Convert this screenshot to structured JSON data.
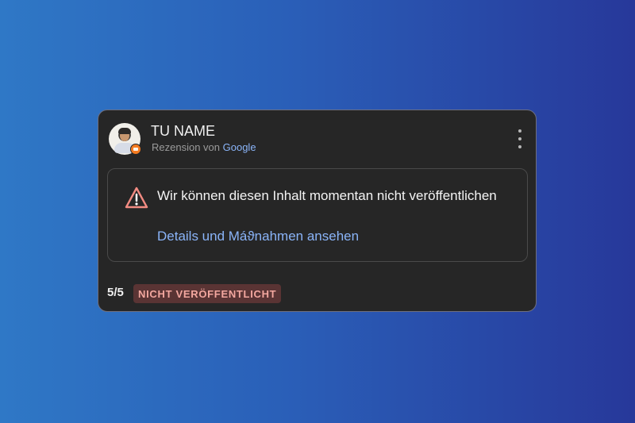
{
  "review_card": {
    "user_name": "TU NAME",
    "source_prefix": "Rezension von",
    "source_provider": "Google",
    "menu_icon": "more-vert-icon",
    "notice": {
      "icon": "warning-icon",
      "message": "Wir können diesen Inhalt momentan nicht veröffentlichen",
      "link_label": "Details und Máϑnahmen ansehen"
    },
    "rating": "5/5",
    "status": "NICHT VERÖFFENTLICHT"
  },
  "colors": {
    "background_start": "#2f78c6",
    "background_end": "#27389a",
    "card_background": "#262626",
    "link": "#8ab4f8",
    "warning": "#f28b82",
    "status_badge_background": "#5a3434",
    "status_badge_text": "#f3a79f"
  }
}
